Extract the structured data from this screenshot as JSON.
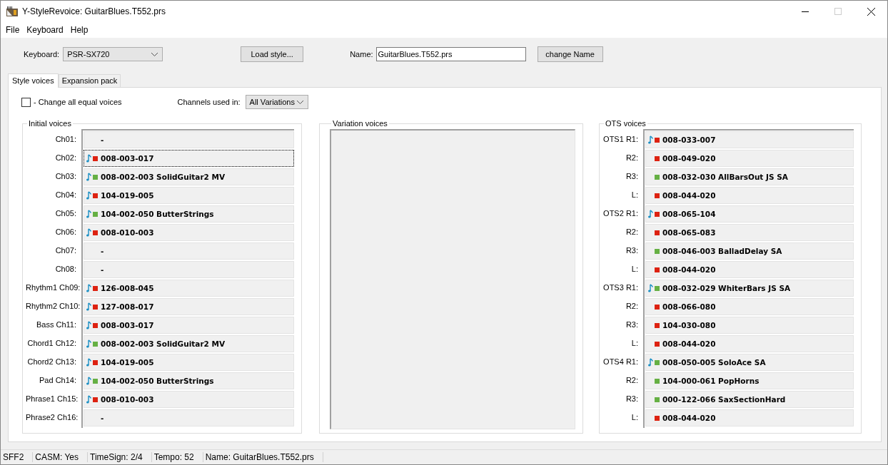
{
  "window": {
    "title": "Y-StyleRevoice: GuitarBlues.T552.prs"
  },
  "menu": [
    "File",
    "Keyboard",
    "Help"
  ],
  "toolbar": {
    "keyboard_label": "Keyboard:",
    "keyboard": "PSR-SX720",
    "load_button": "Load style...",
    "name_label": "Name:",
    "name": "GuitarBlues.T552.prs",
    "change_button": "change Name"
  },
  "tabs": [
    {
      "label": "Style voices",
      "selected": true
    },
    {
      "label": "Expansion pack",
      "selected": false
    }
  ],
  "change_all": {
    "label": "- Change all equal voices",
    "checked": false
  },
  "channels": {
    "label": "Channels used in:",
    "value": "All Variations"
  },
  "initial_voices": {
    "title": "Initial voices",
    "rows": [
      {
        "label": "Ch01:",
        "voice": "-",
        "note": false,
        "selected": false
      },
      {
        "label": "Ch02:",
        "voice": "008-003-017",
        "note": true,
        "color": "#dd2211",
        "selected": true
      },
      {
        "label": "Ch03:",
        "voice": "008-002-003 SolidGuitar2 MV",
        "note": true,
        "color": "#66b044",
        "selected": false
      },
      {
        "label": "Ch04:",
        "voice": "104-019-005",
        "note": true,
        "color": "#dd2211",
        "selected": false
      },
      {
        "label": "Ch05:",
        "voice": "104-002-050 ButterStrings",
        "note": true,
        "color": "#66b044",
        "selected": false
      },
      {
        "label": "Ch06:",
        "voice": "008-010-003",
        "note": true,
        "color": "#dd2211",
        "selected": false
      },
      {
        "label": "Ch07:",
        "voice": "-",
        "note": false,
        "selected": false
      },
      {
        "label": "Ch08:",
        "voice": "-",
        "note": false,
        "selected": false
      },
      {
        "label": "Rhythm1 Ch09:",
        "voice": "126-008-045",
        "note": true,
        "color": "#dd2211",
        "selected": false
      },
      {
        "label": "Rhythm2 Ch10:",
        "voice": "127-008-017",
        "note": true,
        "color": "#dd2211",
        "selected": false
      },
      {
        "label": "Bass Ch11:",
        "voice": "008-003-017",
        "note": true,
        "color": "#dd2211",
        "selected": false
      },
      {
        "label": "Chord1 Ch12:",
        "voice": "008-002-003 SolidGuitar2 MV",
        "note": true,
        "color": "#66b044",
        "selected": false
      },
      {
        "label": "Chord2 Ch13:",
        "voice": "104-019-005",
        "note": true,
        "color": "#dd2211",
        "selected": false
      },
      {
        "label": "Pad Ch14:",
        "voice": "104-002-050 ButterStrings",
        "note": true,
        "color": "#66b044",
        "selected": false
      },
      {
        "label": "Phrase1 Ch15:",
        "voice": "008-010-003",
        "note": true,
        "color": "#dd2211",
        "selected": false
      },
      {
        "label": "Phrase2 Ch16:",
        "voice": "-",
        "note": false,
        "selected": false
      }
    ]
  },
  "variation_voices": {
    "title": "Variation voices"
  },
  "ots_voices": {
    "title": "OTS voices",
    "rows": [
      {
        "label": "OTS1 R1:",
        "voice": "008-033-007",
        "note": true,
        "color": "#dd2211",
        "selected": false
      },
      {
        "label": "R2:",
        "voice": "008-049-020",
        "note": false,
        "color": "#dd2211",
        "selected": false
      },
      {
        "label": "R3:",
        "voice": "008-032-030 AllBarsOut JS SA",
        "note": false,
        "color": "#66b044",
        "selected": false
      },
      {
        "label": "L:",
        "voice": "008-044-020",
        "note": false,
        "color": "#dd2211",
        "selected": false
      },
      {
        "label": "OTS2 R1:",
        "voice": "008-065-104",
        "note": true,
        "color": "#dd2211",
        "selected": false
      },
      {
        "label": "R2:",
        "voice": "008-065-083",
        "note": false,
        "color": "#dd2211",
        "selected": false
      },
      {
        "label": "R3:",
        "voice": "008-046-003 BalladDelay SA",
        "note": false,
        "color": "#66b044",
        "selected": false
      },
      {
        "label": "L:",
        "voice": "008-044-020",
        "note": false,
        "color": "#dd2211",
        "selected": false
      },
      {
        "label": "OTS3 R1:",
        "voice": "008-032-029 WhiterBars JS SA",
        "note": true,
        "color": "#66b044",
        "selected": false
      },
      {
        "label": "R2:",
        "voice": "008-066-080",
        "note": false,
        "color": "#dd2211",
        "selected": false
      },
      {
        "label": "R3:",
        "voice": "104-030-080",
        "note": false,
        "color": "#dd2211",
        "selected": false
      },
      {
        "label": "L:",
        "voice": "008-044-020",
        "note": false,
        "color": "#dd2211",
        "selected": false
      },
      {
        "label": "OTS4 R1:",
        "voice": "008-050-005 SoloAce SA",
        "note": true,
        "color": "#66b044",
        "selected": false
      },
      {
        "label": "R2:",
        "voice": "104-000-061 PopHorns",
        "note": false,
        "color": "#66b044",
        "selected": false
      },
      {
        "label": "R3:",
        "voice": "000-122-066 SaxSectionHard",
        "note": false,
        "color": "#66b044",
        "selected": false
      },
      {
        "label": "L:",
        "voice": "008-044-020",
        "note": false,
        "color": "#dd2211",
        "selected": false
      }
    ]
  },
  "status_bar": [
    "SFF2",
    "CASM: Yes",
    "TimeSign: 2/4",
    "Tempo: 52",
    "Name: GuitarBlues.T552.prs"
  ]
}
